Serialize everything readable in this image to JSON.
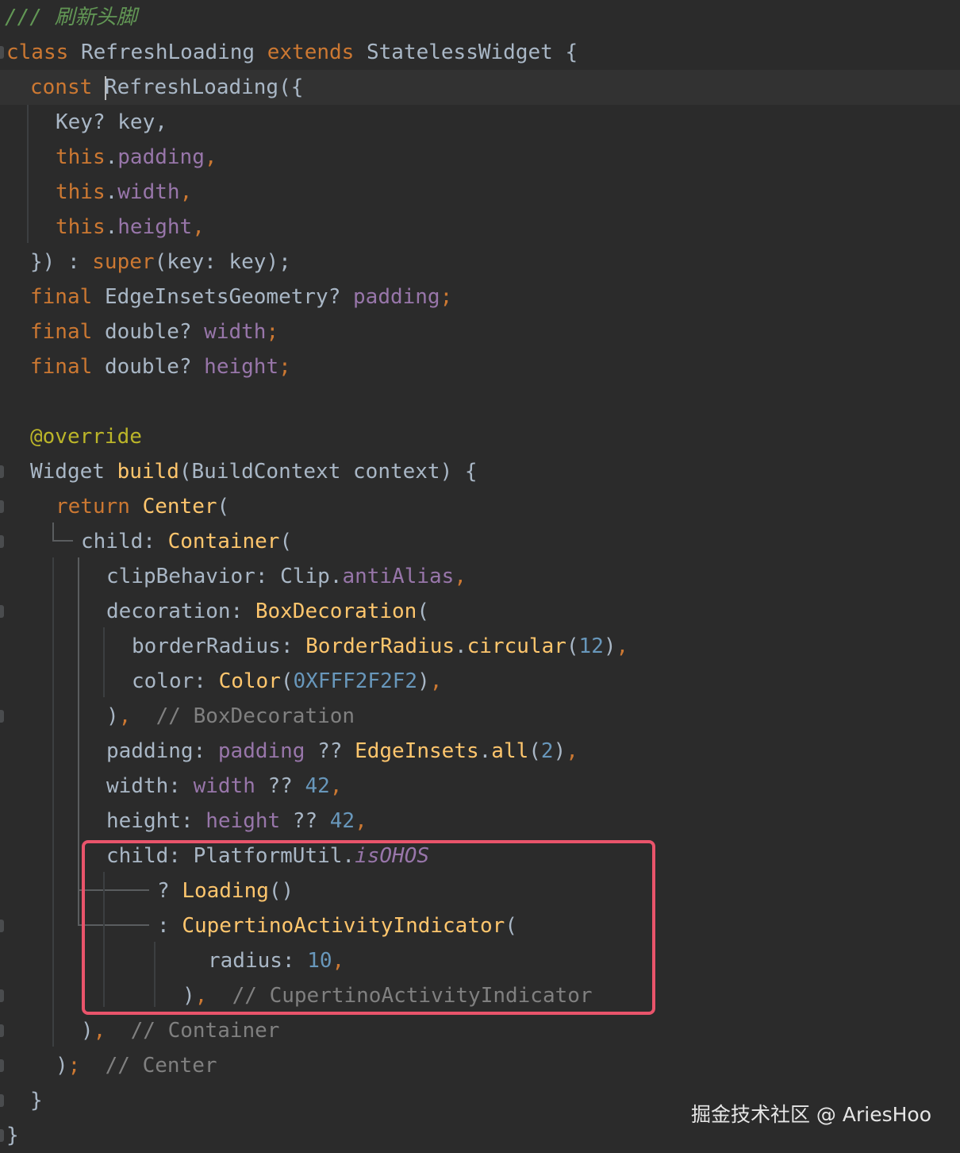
{
  "code": {
    "doc_comment": "/// 刷新头脚",
    "kw_class": "class",
    "class_name": "RefreshLoading",
    "kw_extends": "extends",
    "super_class": "StatelessWidget",
    "brace_open": " {",
    "kw_const": "const",
    "ctor_name": "RefreshLoading",
    "ctor_open": "({",
    "key_param": "Key? key,",
    "kw_this": "this",
    "p_padding": "padding",
    "p_width": "width",
    "p_height": "height",
    "comma": ",",
    "super_prefix": "}) : ",
    "kw_super": "super",
    "super_args": "(key: key);",
    "kw_final": "final",
    "t_edge": "EdgeInsetsGeometry?",
    "t_double": "double?",
    "semi": ";",
    "annotation": "@override",
    "build_type": "Widget ",
    "build_name": "build",
    "build_args": "(BuildContext context) {",
    "kw_return": "return",
    "center": "Center",
    "paren_open": "(",
    "child_label": "child: ",
    "container": "Container",
    "clip_label": "clipBehavior: ",
    "clip_cls": "Clip",
    "anti_alias": "antiAlias",
    "decoration_label": "decoration: ",
    "box_decoration": "BoxDecoration",
    "border_radius_label": "borderRadius: ",
    "border_radius_cls": "BorderRadius",
    "circular": "circular",
    "radius_12": "12",
    "color_label": "color: ",
    "color_cls": "Color",
    "color_val": "0XFFF2F2F2",
    "close_paren": ")",
    "close_paren_comma": "),",
    "cmt_box": "// BoxDecoration",
    "padding_label": "padding: ",
    "null_coalesce": " ?? ",
    "edge_insets": "EdgeInsets",
    "all": "all",
    "num_2": "2",
    "width_label": "width: ",
    "num_42": "42",
    "height_label": "height: ",
    "platform_util": "PlatformUtil.",
    "is_ohos": "isOHOS",
    "ternary_q": "? ",
    "loading": "Loading",
    "empty_call": "()",
    "ternary_c": ": ",
    "cupertino": "CupertinoActivityIndicator",
    "radius_label": "radius: ",
    "num_10": "10",
    "cmt_cupertino": "// CupertinoActivityIndicator",
    "cmt_container": "// Container",
    "center_close": ");",
    "cmt_center": "// Center",
    "brace_close": "}"
  },
  "watermark": "掘金技术社区 @ AriesHoo",
  "colors": {
    "background": "#2b2b2b",
    "keyword": "#cc7832",
    "function": "#ffc66d",
    "field": "#9876aa",
    "number": "#6897bb",
    "comment": "#808080",
    "doc_comment": "#629755",
    "annotation": "#bbb529",
    "highlight_box": "#e9546b"
  }
}
